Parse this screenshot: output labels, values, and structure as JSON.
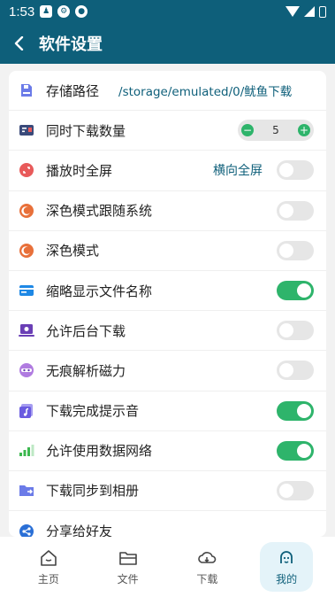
{
  "status_bar": {
    "time": "1:53",
    "icons": [
      "shirt-icon",
      "settings-circle-icon",
      "notification-circle-icon"
    ]
  },
  "header": {
    "title": "软件设置"
  },
  "settings": [
    {
      "id": "storage",
      "label": "存储路径",
      "value": "/storage/emulated/0/鱿鱼下载",
      "icon": "sd-card-icon",
      "icon_color": "#5b6de0"
    },
    {
      "id": "concurrent",
      "label": "同时下载数量",
      "value": "5",
      "minus": "−",
      "plus": "+",
      "icon": "queue-icon",
      "icon_color": "#3a4a7a"
    },
    {
      "id": "fullscreen",
      "label": "播放时全屏",
      "value": "横向全屏",
      "enabled": false,
      "icon": "fullscreen-icon",
      "icon_color": "#e85a5a"
    },
    {
      "id": "dark_follow",
      "label": "深色模式跟随系统",
      "enabled": false,
      "icon": "moon-icon",
      "icon_color": "#e8703a"
    },
    {
      "id": "dark_mode",
      "label": "深色模式",
      "enabled": false,
      "icon": "moon-icon",
      "icon_color": "#e8703a"
    },
    {
      "id": "short_name",
      "label": "缩略显示文件名称",
      "enabled": true,
      "icon": "card-icon",
      "icon_color": "#1e88e5"
    },
    {
      "id": "background_dl",
      "label": "允许后台下载",
      "enabled": false,
      "icon": "laptop-icon",
      "icon_color": "#6a3fb5"
    },
    {
      "id": "incognito",
      "label": "无痕解析磁力",
      "enabled": false,
      "icon": "mask-icon",
      "icon_color": "#9c5bd6"
    },
    {
      "id": "complete_sound",
      "label": "下载完成提示音",
      "enabled": true,
      "icon": "music-icon",
      "icon_color": "#6a5be0"
    },
    {
      "id": "mobile_data",
      "label": "允许使用数据网络",
      "enabled": true,
      "icon": "signal-icon",
      "icon_color": "#3cb84f"
    },
    {
      "id": "sync_album",
      "label": "下载同步到相册",
      "enabled": false,
      "icon": "folder-icon",
      "icon_color": "#5b6de0"
    },
    {
      "id": "share",
      "label": "分享给好友",
      "icon": "share-icon",
      "icon_color": "#2a6fd6"
    }
  ],
  "nav": [
    {
      "label": "主页",
      "icon": "home-icon",
      "active": false
    },
    {
      "label": "文件",
      "icon": "folder-open-icon",
      "active": false
    },
    {
      "label": "下载",
      "icon": "cloud-download-icon",
      "active": false
    },
    {
      "label": "我的",
      "icon": "profile-icon",
      "active": true
    }
  ],
  "colors": {
    "primary": "#0e5f7a",
    "toggle_on": "#2eb46b",
    "toggle_off": "#e6e6e6"
  }
}
